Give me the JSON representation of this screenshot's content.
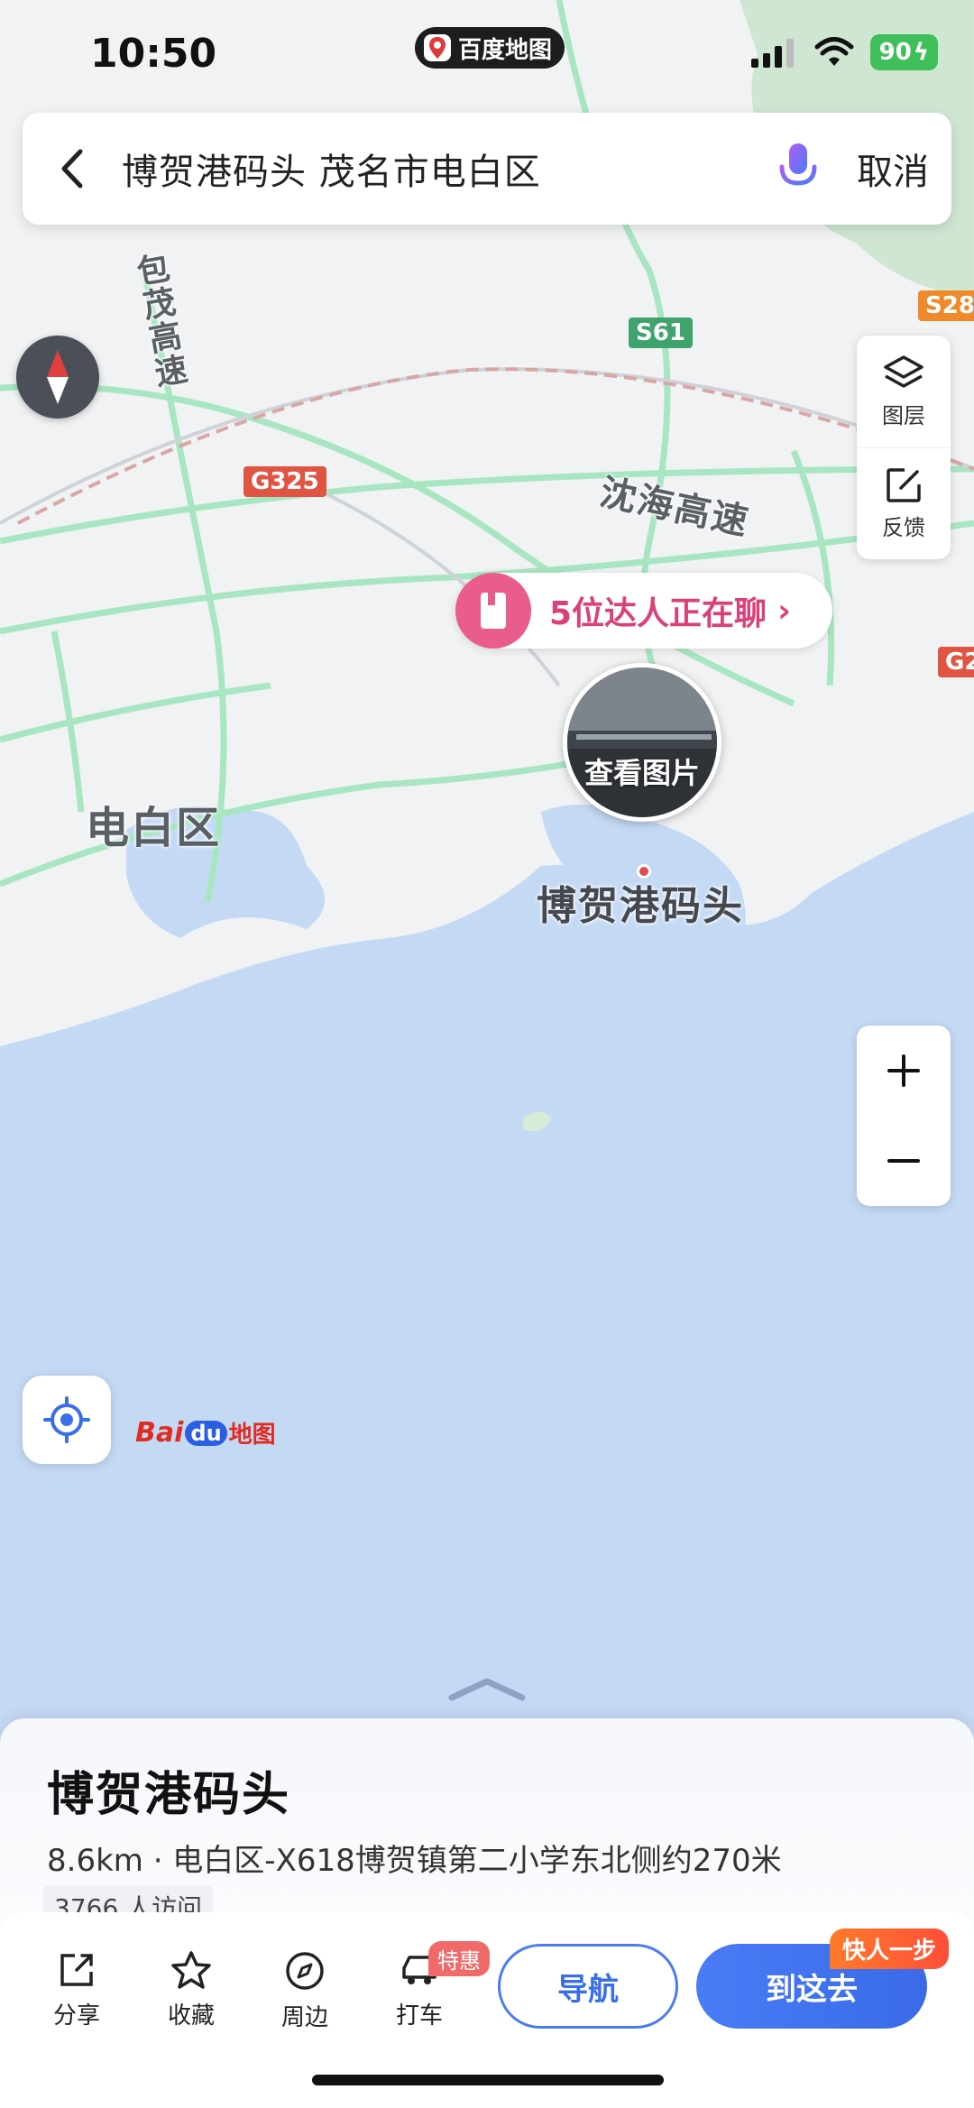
{
  "status_bar": {
    "time": "10:50",
    "app_name": "百度地图",
    "battery": "90"
  },
  "search": {
    "query": "博贺港码头 茂名市电白区",
    "cancel_label": "取消"
  },
  "map": {
    "roads": {
      "g325": "G325",
      "s61": "S61",
      "s28": "S28",
      "g2": "G2"
    },
    "labels": {
      "baomao": "包茂高速",
      "shenhai": "沈海高速",
      "district": "电白区"
    },
    "chat_bubble": "5位达人正在聊",
    "photo_label": "查看图片",
    "poi_name": "博贺港码头",
    "layers_label": "图层",
    "feedback_label": "反馈"
  },
  "sheet": {
    "title": "博贺港码头",
    "address": "8.6km · 电白区-X618博贺镇第二小学东北侧约270米",
    "visits": "3766 人访问"
  },
  "actions": {
    "share": "分享",
    "favorite": "收藏",
    "nearby": "周边",
    "taxi": "打车",
    "taxi_tag": "特惠",
    "navigate": "导航",
    "go": "到这去",
    "go_tag": "快人一步"
  },
  "colors": {
    "sea": "#c4d9f4",
    "land": "#f2f3f4",
    "road": "#a8e6c2",
    "accent": "#3a6ee8"
  }
}
